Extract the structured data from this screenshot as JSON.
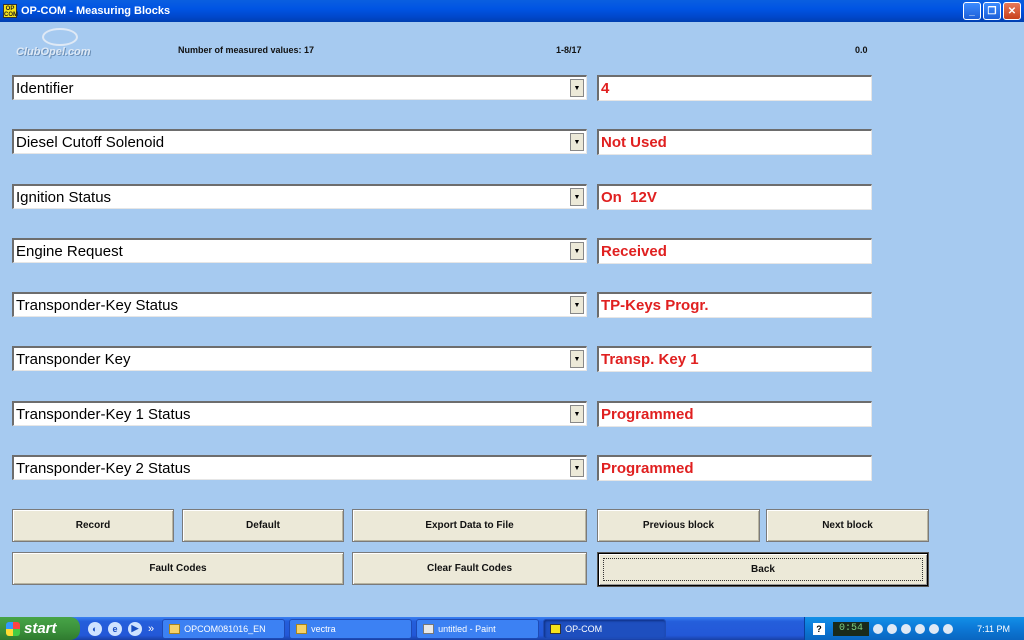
{
  "window": {
    "title": "OP-COM - Measuring Blocks",
    "app_icon_text": "OP COM",
    "minimize_glyph": "_",
    "maximize_glyph": "❐",
    "close_glyph": "✕"
  },
  "header": {
    "logo_text": "ClubOpel.com",
    "measured_label": "Number of measured values: 17",
    "page_range": "1-8/17",
    "timer": "0.0"
  },
  "rows": [
    {
      "label": "Identifier",
      "value": "4"
    },
    {
      "label": "Diesel Cutoff Solenoid",
      "value": "Not Used"
    },
    {
      "label": "Ignition Status",
      "value": "On  12V"
    },
    {
      "label": "Engine Request",
      "value": "Received"
    },
    {
      "label": "Transponder-Key Status",
      "value": "TP-Keys Progr."
    },
    {
      "label": "Transponder Key",
      "value": "Transp. Key 1"
    },
    {
      "label": "Transponder-Key 1 Status",
      "value": "Programmed"
    },
    {
      "label": "Transponder-Key 2 Status",
      "value": "Programmed"
    }
  ],
  "dropdown_glyph": "▼",
  "buttons": {
    "record": "Record",
    "default": "Default",
    "export": "Export Data to File",
    "previous": "Previous block",
    "next": "Next block",
    "fault_codes": "Fault Codes",
    "clear_fault_codes": "Clear Fault Codes",
    "back": "Back"
  },
  "taskbar": {
    "start": "start",
    "ql_more": "»",
    "tasks": [
      {
        "label": "OPCOM081016_EN",
        "icon": "folder-icon"
      },
      {
        "label": "vectra",
        "icon": "folder-icon"
      },
      {
        "label": "untitled - Paint",
        "icon": "paint-icon"
      },
      {
        "label": "OP-COM",
        "icon": "opcom-icon"
      }
    ],
    "tray_help": "?",
    "tray_meter": "0:54",
    "clock": "7:11 PM"
  },
  "colors": {
    "background": "#a6caf0",
    "value_text": "#e02020",
    "button_face": "#ece9d8"
  }
}
